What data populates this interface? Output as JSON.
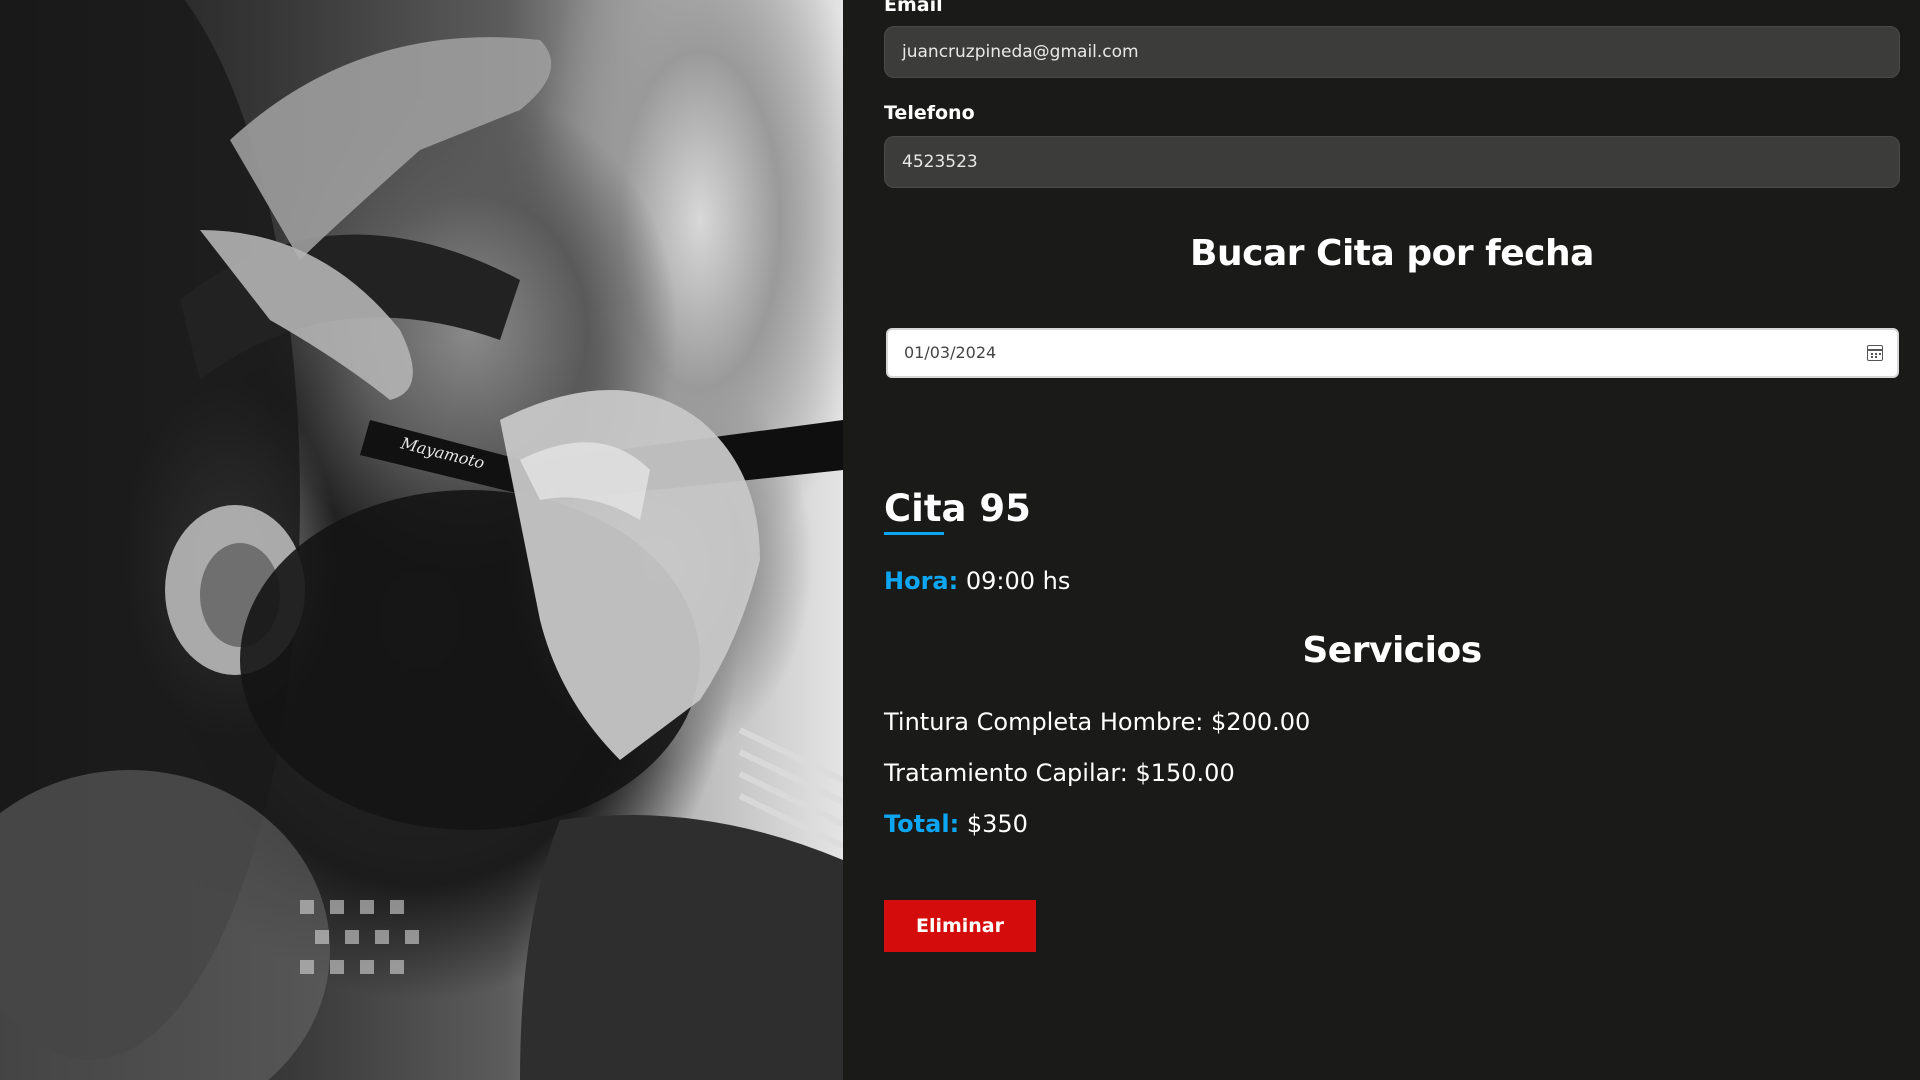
{
  "form": {
    "email_label": "Email",
    "email_value": "juancruzpineda@gmail.com",
    "phone_label": "Telefono",
    "phone_value": "4523523"
  },
  "search": {
    "title": "Bucar Cita por fecha",
    "date_value": "01/03/2024",
    "calendar_icon": "calendar-icon"
  },
  "appointment": {
    "title": "Cita 95",
    "hour_label": "Hora:",
    "hour_value": "09:00 hs",
    "services_title": "Servicios",
    "services": [
      {
        "text": "Tintura Completa Hombre: $200.00"
      },
      {
        "text": "Tratamiento Capilar: $150.00"
      }
    ],
    "total_label": "Total:",
    "total_value": "$350",
    "delete_label": "Eliminar"
  },
  "colors": {
    "background": "#1a1a18",
    "accent_blue": "#0da6f2",
    "delete_red": "#d50c0c",
    "input_bg": "#3c3c3a"
  }
}
